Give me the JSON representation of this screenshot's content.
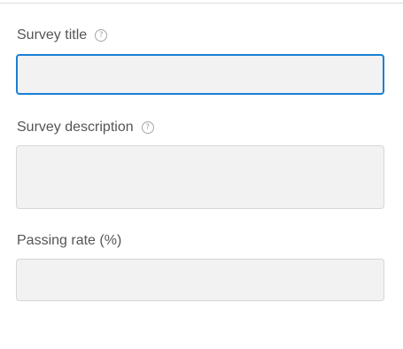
{
  "form": {
    "fields": [
      {
        "label": "Survey title",
        "value": "",
        "has_help": true,
        "focused": true
      },
      {
        "label": "Survey description",
        "value": "",
        "has_help": true,
        "focused": false
      },
      {
        "label": "Passing rate (%)",
        "value": "",
        "has_help": false,
        "focused": false
      }
    ],
    "help_icon_glyph": "?"
  },
  "colors": {
    "focus_border": "#1a7fd4",
    "input_background": "#f2f2f2",
    "input_border": "#d6d6d6",
    "label_text": "#555555"
  }
}
